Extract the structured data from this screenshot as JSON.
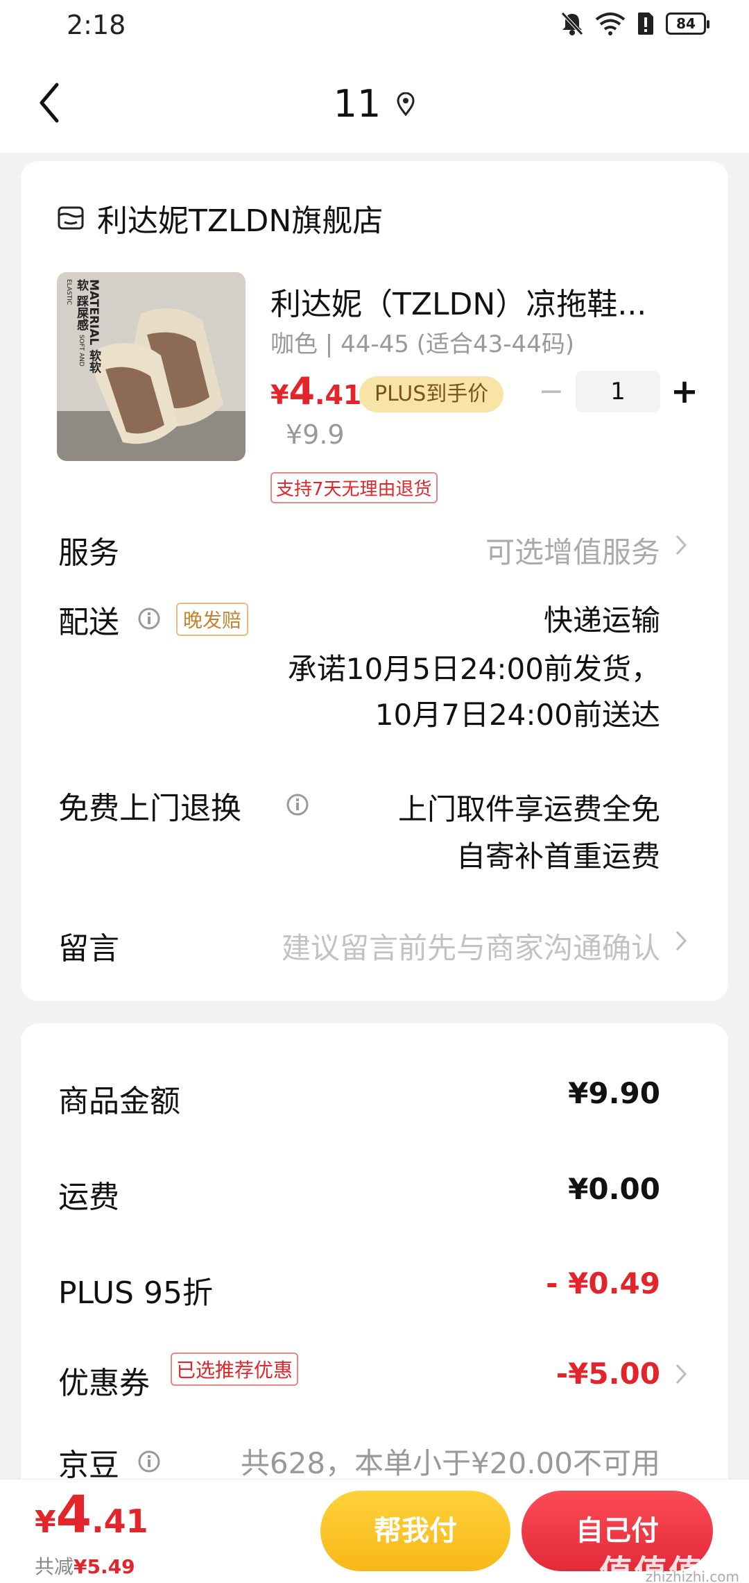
{
  "status_bar": {
    "time": "2:18",
    "battery": "84"
  },
  "nav": {
    "title": "11"
  },
  "shop": {
    "name": "利达妮TZLDN旗舰店"
  },
  "product": {
    "title": "利达妮（TZLDN）凉拖鞋...",
    "spec": "咖色 | 44-45 (适合43-44码)",
    "price_currency": "¥",
    "price_int": "4",
    "price_dec": ".41",
    "plus_label": "PLUS到手价",
    "original_price": "¥9.9",
    "quantity": "1",
    "minus": "−",
    "plus": "+",
    "return_policy": "支持7天无理由退货",
    "image_text": {
      "line1": "MATERIAL",
      "line2": "软软软 踩屎感",
      "line3": "SOFT AND ELASTIC"
    }
  },
  "service": {
    "label": "服务",
    "value": "可选增值服务"
  },
  "delivery": {
    "label": "配送",
    "tag": "晚发赔",
    "method": "快递运输",
    "line1": "承诺10月5日24:00前发货，",
    "line2": "10月7日24:00前送达"
  },
  "free_return": {
    "label": "免费上门退换",
    "line1": "上门取件享运费全免",
    "line2": "自寄补首重运费"
  },
  "message": {
    "label": "留言",
    "placeholder": "建议留言前先与商家沟通确认"
  },
  "summary": {
    "goods_label": "商品金额",
    "goods_value": "¥9.90",
    "shipping_label": "运费",
    "shipping_value": "¥0.00",
    "plus_label": "PLUS 95折",
    "plus_value": "- ¥0.49",
    "coupon_label": "优惠券",
    "coupon_tag": "已选推荐优惠",
    "coupon_value": "-¥5.00",
    "jd_label": "京豆",
    "jd_value": "共628，本单小于¥20.00不可用"
  },
  "bottom": {
    "total_currency": "¥",
    "total_int": "4",
    "total_dec": ".41",
    "saved_label": "共减",
    "saved_value": "¥5.49",
    "help_pay": "帮我付",
    "self_pay": "自己付",
    "watermark": "值值值",
    "watermark_url": "zhizhizhi.com"
  },
  "colors": {
    "accent_red": "#e3242b",
    "plus_gold": "#f8e4a6",
    "help_button": "#f8b719",
    "self_button": "#e32a38"
  }
}
